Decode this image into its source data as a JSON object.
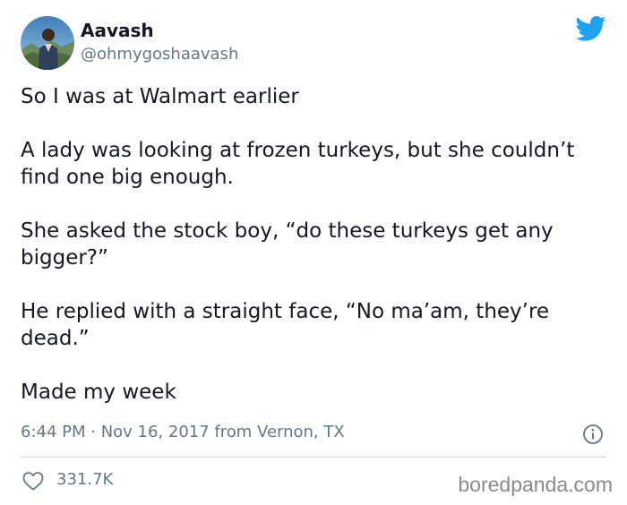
{
  "author": {
    "display_name": "Aavash",
    "handle": "@ohmygoshaavash",
    "avatar_icon": "profile-photo"
  },
  "brand": {
    "icon": "twitter-bird-icon",
    "color": "#1DA1F2"
  },
  "tweet": {
    "paragraphs": [
      "So I was at Walmart earlier",
      "A lady was looking at frozen turkeys, but she couldn’t find one big enough.",
      "She asked the stock boy, “do these turkeys get any bigger?”",
      "He replied with a straight face, “No ma’am, they’re dead.”",
      "Made my week"
    ]
  },
  "meta": {
    "timestamp": "6:44 PM · Nov 16, 2017 from Vernon, TX"
  },
  "stats": {
    "likes": "331.7K"
  },
  "watermark": {
    "text": "boredpanda.com"
  },
  "colors": {
    "text": "#141823",
    "muted": "#657786",
    "divider": "#cfd9de"
  }
}
